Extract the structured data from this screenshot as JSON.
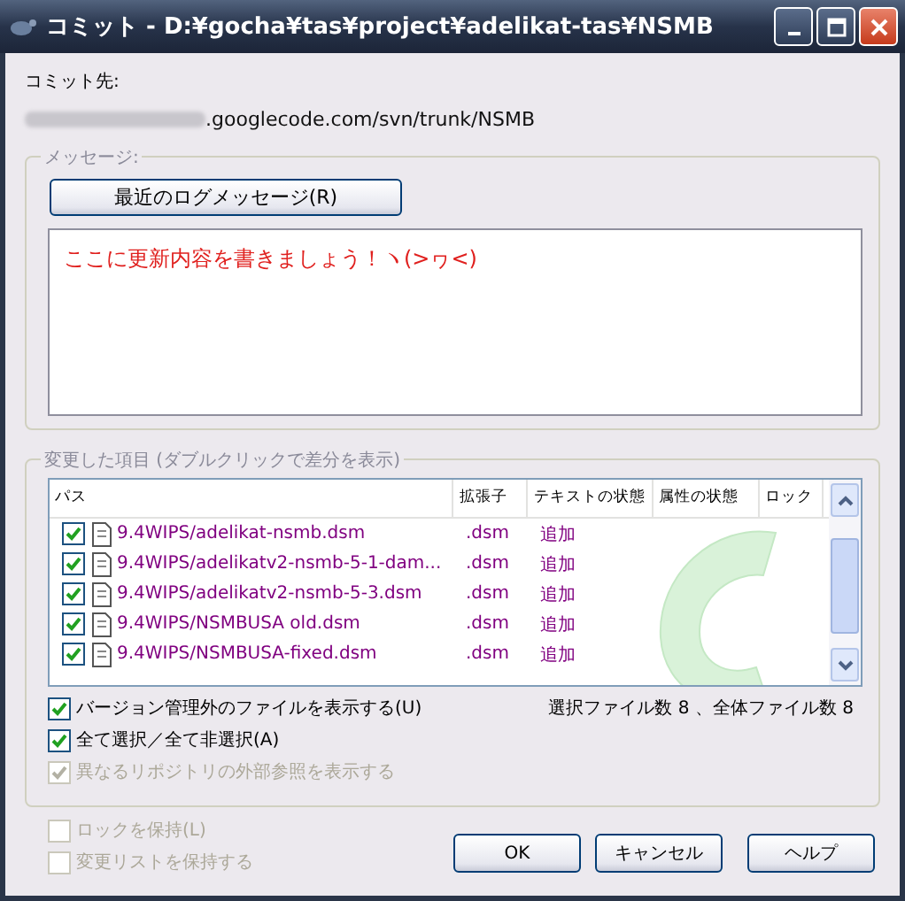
{
  "window": {
    "title": "コミット - D:¥gocha¥tas¥project¥adelikat-tas¥NSMB"
  },
  "commit_to": {
    "label": "コミット先:",
    "url": ".googlecode.com/svn/trunk/NSMB"
  },
  "message": {
    "legend": "メッセージ:",
    "recent_button": "最近のログメッセージ(R)",
    "value": "ここに更新内容を書きましょう！ヽ(>ヮ<)"
  },
  "changes": {
    "legend": "変更した項目 (ダブルクリックで差分を表示)",
    "columns": [
      "パス",
      "拡張子",
      "テキストの状態",
      "属性の状態",
      "ロック"
    ],
    "rows": [
      {
        "checked": true,
        "path": "9.4WIPS/adelikat-nsmb.dsm",
        "ext": ".dsm",
        "status": "追加"
      },
      {
        "checked": true,
        "path": "9.4WIPS/adelikatv2-nsmb-5-1-dam...",
        "ext": ".dsm",
        "status": "追加"
      },
      {
        "checked": true,
        "path": "9.4WIPS/adelikatv2-nsmb-5-3.dsm",
        "ext": ".dsm",
        "status": "追加"
      },
      {
        "checked": true,
        "path": "9.4WIPS/NSMBUSA old.dsm",
        "ext": ".dsm",
        "status": "追加"
      },
      {
        "checked": true,
        "path": "9.4WIPS/NSMBUSA-fixed.dsm",
        "ext": ".dsm",
        "status": "追加"
      }
    ],
    "options": [
      {
        "label": "バージョン管理外のファイルを表示する(U)",
        "checked": true,
        "disabled": false
      },
      {
        "label": "全て選択／全て非選択(A)",
        "checked": true,
        "disabled": false
      },
      {
        "label": "異なるリポジトリの外部参照を表示する",
        "checked": true,
        "disabled": true
      }
    ],
    "count": "選択ファイル数 8 、全体ファイル数 8"
  },
  "bottom_options": [
    {
      "label": "ロックを保持(L)",
      "checked": false,
      "disabled": true
    },
    {
      "label": "変更リストを保持する",
      "checked": false,
      "disabled": true
    }
  ],
  "buttons": [
    "OK",
    "キャンセル",
    "ヘルプ"
  ]
}
